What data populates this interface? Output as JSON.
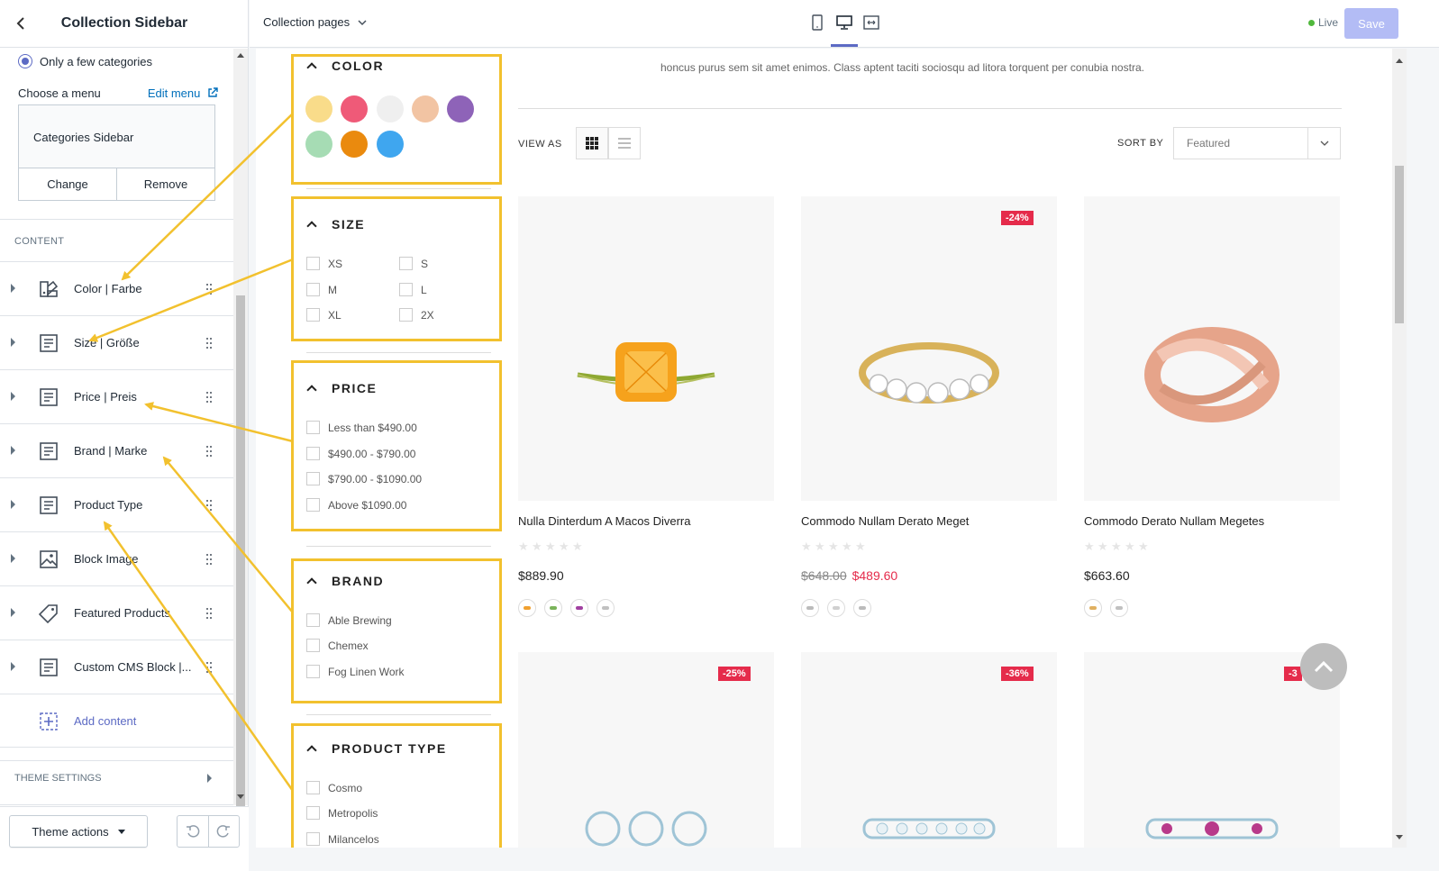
{
  "sidebar": {
    "title": "Collection Sidebar",
    "radio_label": "Only a few categories",
    "choose_menu_label": "Choose a menu",
    "edit_menu_label": "Edit menu",
    "menu_name": "Categories Sidebar",
    "change_label": "Change",
    "remove_label": "Remove",
    "content_heading": "CONTENT",
    "blocks": [
      {
        "label": "Color | Farbe",
        "icon": "color-icon"
      },
      {
        "label": "Size | Größe",
        "icon": "text-block-icon"
      },
      {
        "label": "Price | Preis",
        "icon": "text-block-icon"
      },
      {
        "label": "Brand | Marke",
        "icon": "text-block-icon"
      },
      {
        "label": "Product Type",
        "icon": "text-block-icon"
      },
      {
        "label": "Block Image",
        "icon": "image-icon"
      },
      {
        "label": "Featured Products",
        "icon": "tag-icon"
      },
      {
        "label": "Custom CMS Block |...",
        "icon": "text-block-icon"
      }
    ],
    "add_content_label": "Add content",
    "theme_settings_label": "THEME SETTINGS",
    "theme_actions_label": "Theme actions"
  },
  "topbar": {
    "pages_label": "Collection pages",
    "live_label": "Live",
    "save_label": "Save"
  },
  "preview": {
    "description": "honcus purus sem sit amet enimos. Class aptent taciti sociosqu ad litora torquent per conubia nostra.",
    "view_as_label": "VIEW AS",
    "sort_by_label": "SORT BY",
    "sort_value": "Featured",
    "filters": {
      "color": {
        "title": "COLOR",
        "swatches": [
          "#f9dc8a",
          "#ef5a78",
          "#efefef",
          "#f2c4a3",
          "#8e63b8",
          "#a6dcb4",
          "#ea8a0e",
          "#3fa6ef"
        ]
      },
      "size": {
        "title": "SIZE",
        "options": [
          "XS",
          "S",
          "M",
          "L",
          "XL",
          "2X"
        ]
      },
      "price": {
        "title": "PRICE",
        "options": [
          "Less than $490.00",
          "$490.00 - $790.00",
          "$790.00 - $1090.00",
          "Above $1090.00"
        ]
      },
      "brand": {
        "title": "BRAND",
        "options": [
          "Able Brewing",
          "Chemex",
          "Fog Linen Work"
        ]
      },
      "product_type": {
        "title": "PRODUCT TYPE",
        "options": [
          "Cosmo",
          "Metropolis",
          "Milancelos"
        ]
      }
    },
    "products": [
      {
        "name": "Nulla Dinterdum A Macos Diverra",
        "price": "$889.90",
        "old_price": "",
        "badge": "",
        "swatch_colors": [
          "#f0a030",
          "#7ab35a",
          "#a040a0",
          "#c0c0c0"
        ]
      },
      {
        "name": "Commodo Nullam Derato Meget",
        "price": "$489.60",
        "old_price": "$648.00",
        "badge": "-24%",
        "swatch_colors": [
          "#bbbbbb",
          "#d0d0d0",
          "#bbbbbb"
        ]
      },
      {
        "name": "Commodo Derato Nullam Megetes",
        "price": "$663.60",
        "old_price": "",
        "badge": "",
        "swatch_colors": [
          "#e0b060",
          "#c0c0c0"
        ]
      }
    ],
    "row2_badges": [
      "-25%",
      "-36%",
      "-3"
    ]
  }
}
